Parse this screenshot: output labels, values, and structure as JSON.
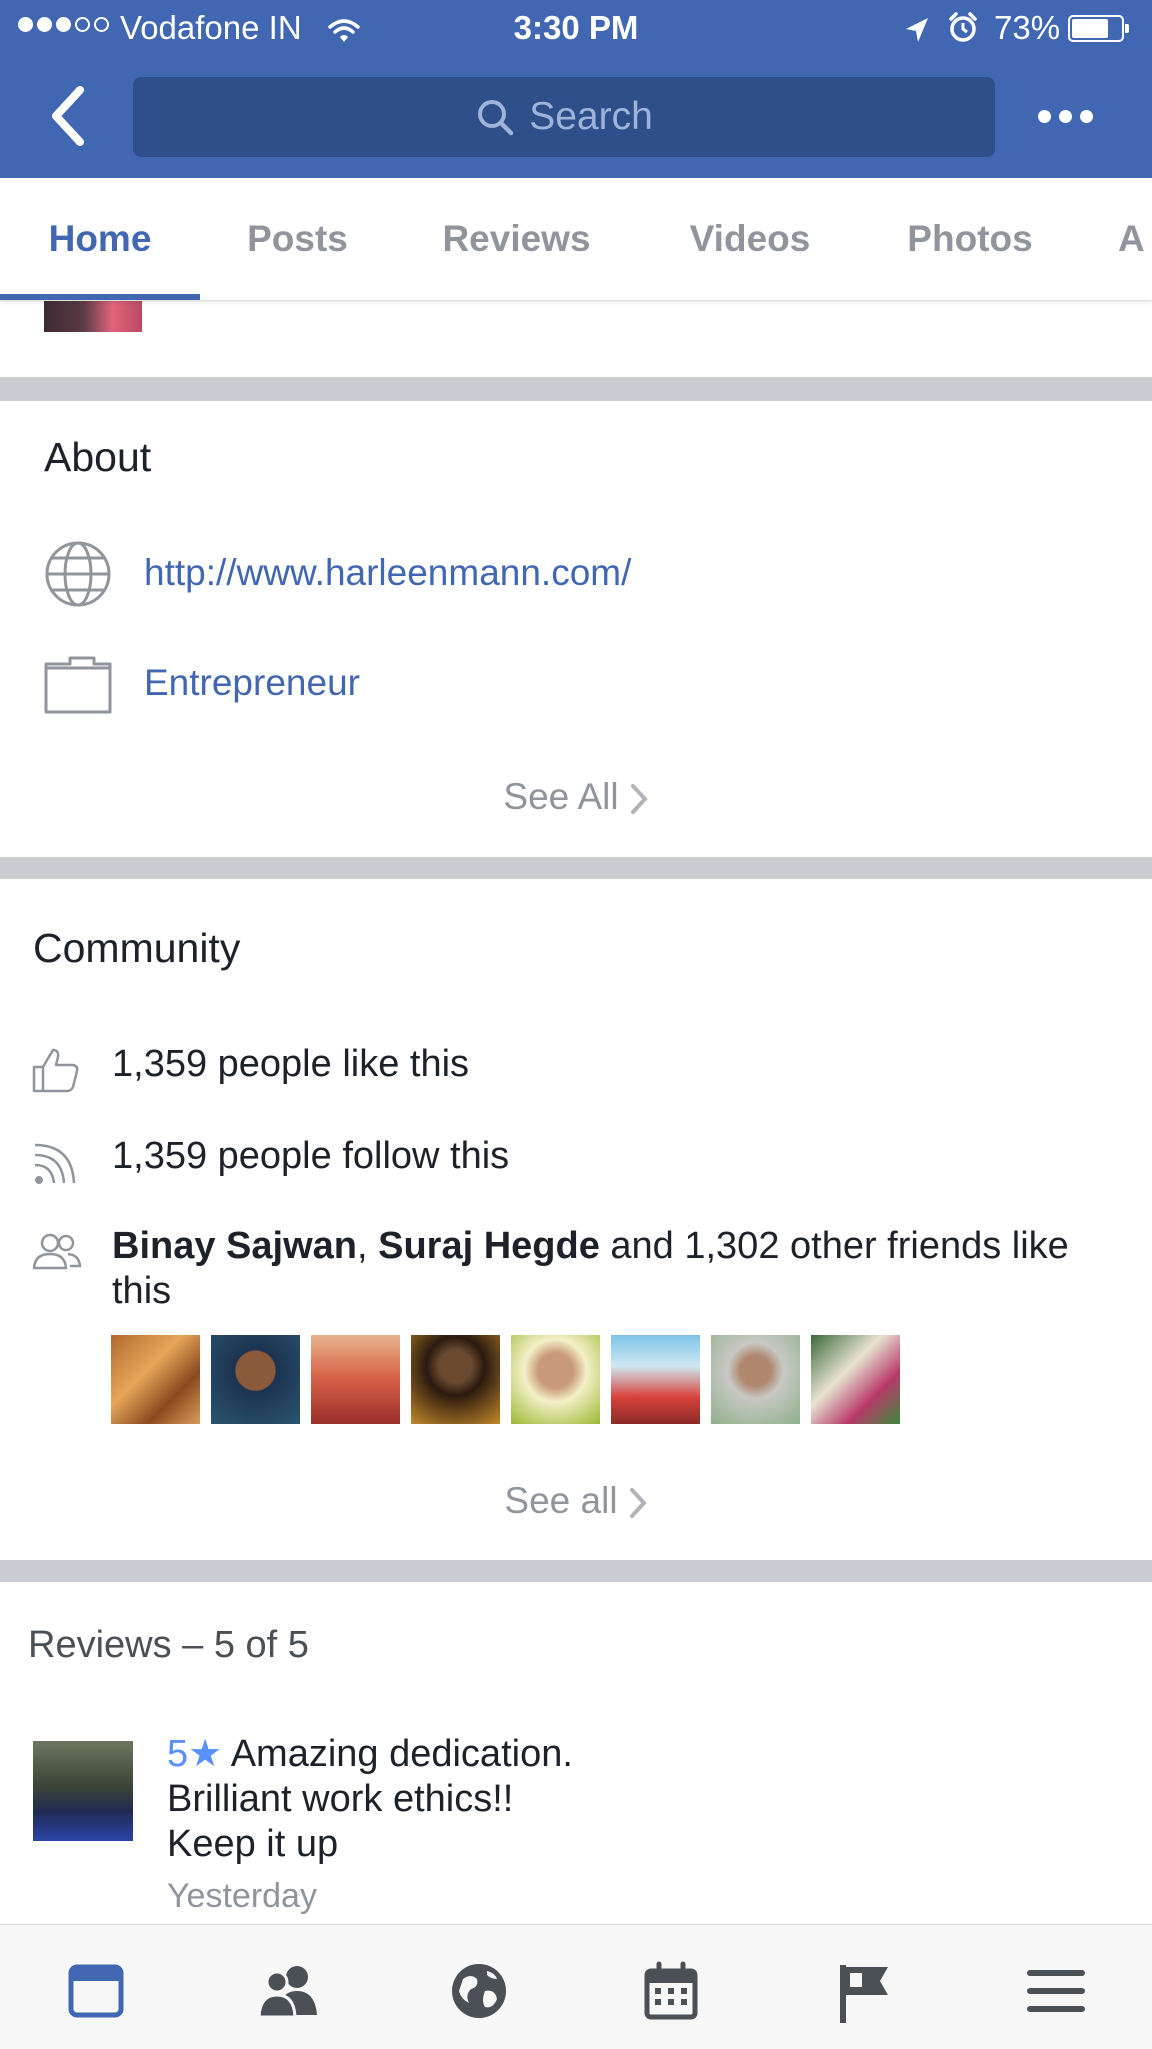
{
  "status_bar": {
    "carrier": "Vodafone IN",
    "time": "3:30 PM",
    "battery": "73%",
    "battery_level": 0.73,
    "signal_dots_filled": 3,
    "signal_dots_total": 5
  },
  "header": {
    "search_placeholder": "Search"
  },
  "tabs": [
    {
      "label": "Home",
      "active": true
    },
    {
      "label": "Posts",
      "active": false
    },
    {
      "label": "Reviews",
      "active": false
    },
    {
      "label": "Videos",
      "active": false
    },
    {
      "label": "Photos",
      "active": false
    },
    {
      "label": "A",
      "active": false
    }
  ],
  "about": {
    "title": "About",
    "website": "http://www.harleenmann.com/",
    "category": "Entrepreneur",
    "see_all": "See All"
  },
  "community": {
    "title": "Community",
    "likes": "1,359 people like this",
    "follows": "1,359 people follow this",
    "friend_1": "Binay Sajwan",
    "separator": ", ",
    "friend_2": "Suraj Hegde",
    "friends_rest": " and 1,302 other friends like this",
    "see_all": "See all"
  },
  "reviews": {
    "title": "Reviews – 5 of 5",
    "items": [
      {
        "rating": "5",
        "star": "★",
        "line1": "Amazing dedication.",
        "line2": "Brilliant work ethics!!",
        "line3": "Keep it up",
        "time": "Yesterday"
      }
    ]
  },
  "colors": {
    "brand_blue": "#4267b2",
    "search_bg": "#2f4f8a",
    "link_blue": "#4267b2",
    "rating_blue": "#5890ff",
    "muted_gray": "#90949c",
    "separator_gray": "#cacdd2"
  },
  "icons": [
    "back-arrow-icon",
    "search-icon",
    "more-icon",
    "globe-icon",
    "briefcase-icon",
    "chevron-right-icon",
    "thumbs-up-icon",
    "rss-icon",
    "friends-icon",
    "news-feed-icon",
    "friend-requests-icon",
    "notifications-globe-icon",
    "events-icon",
    "pages-flag-icon",
    "menu-icon"
  ]
}
